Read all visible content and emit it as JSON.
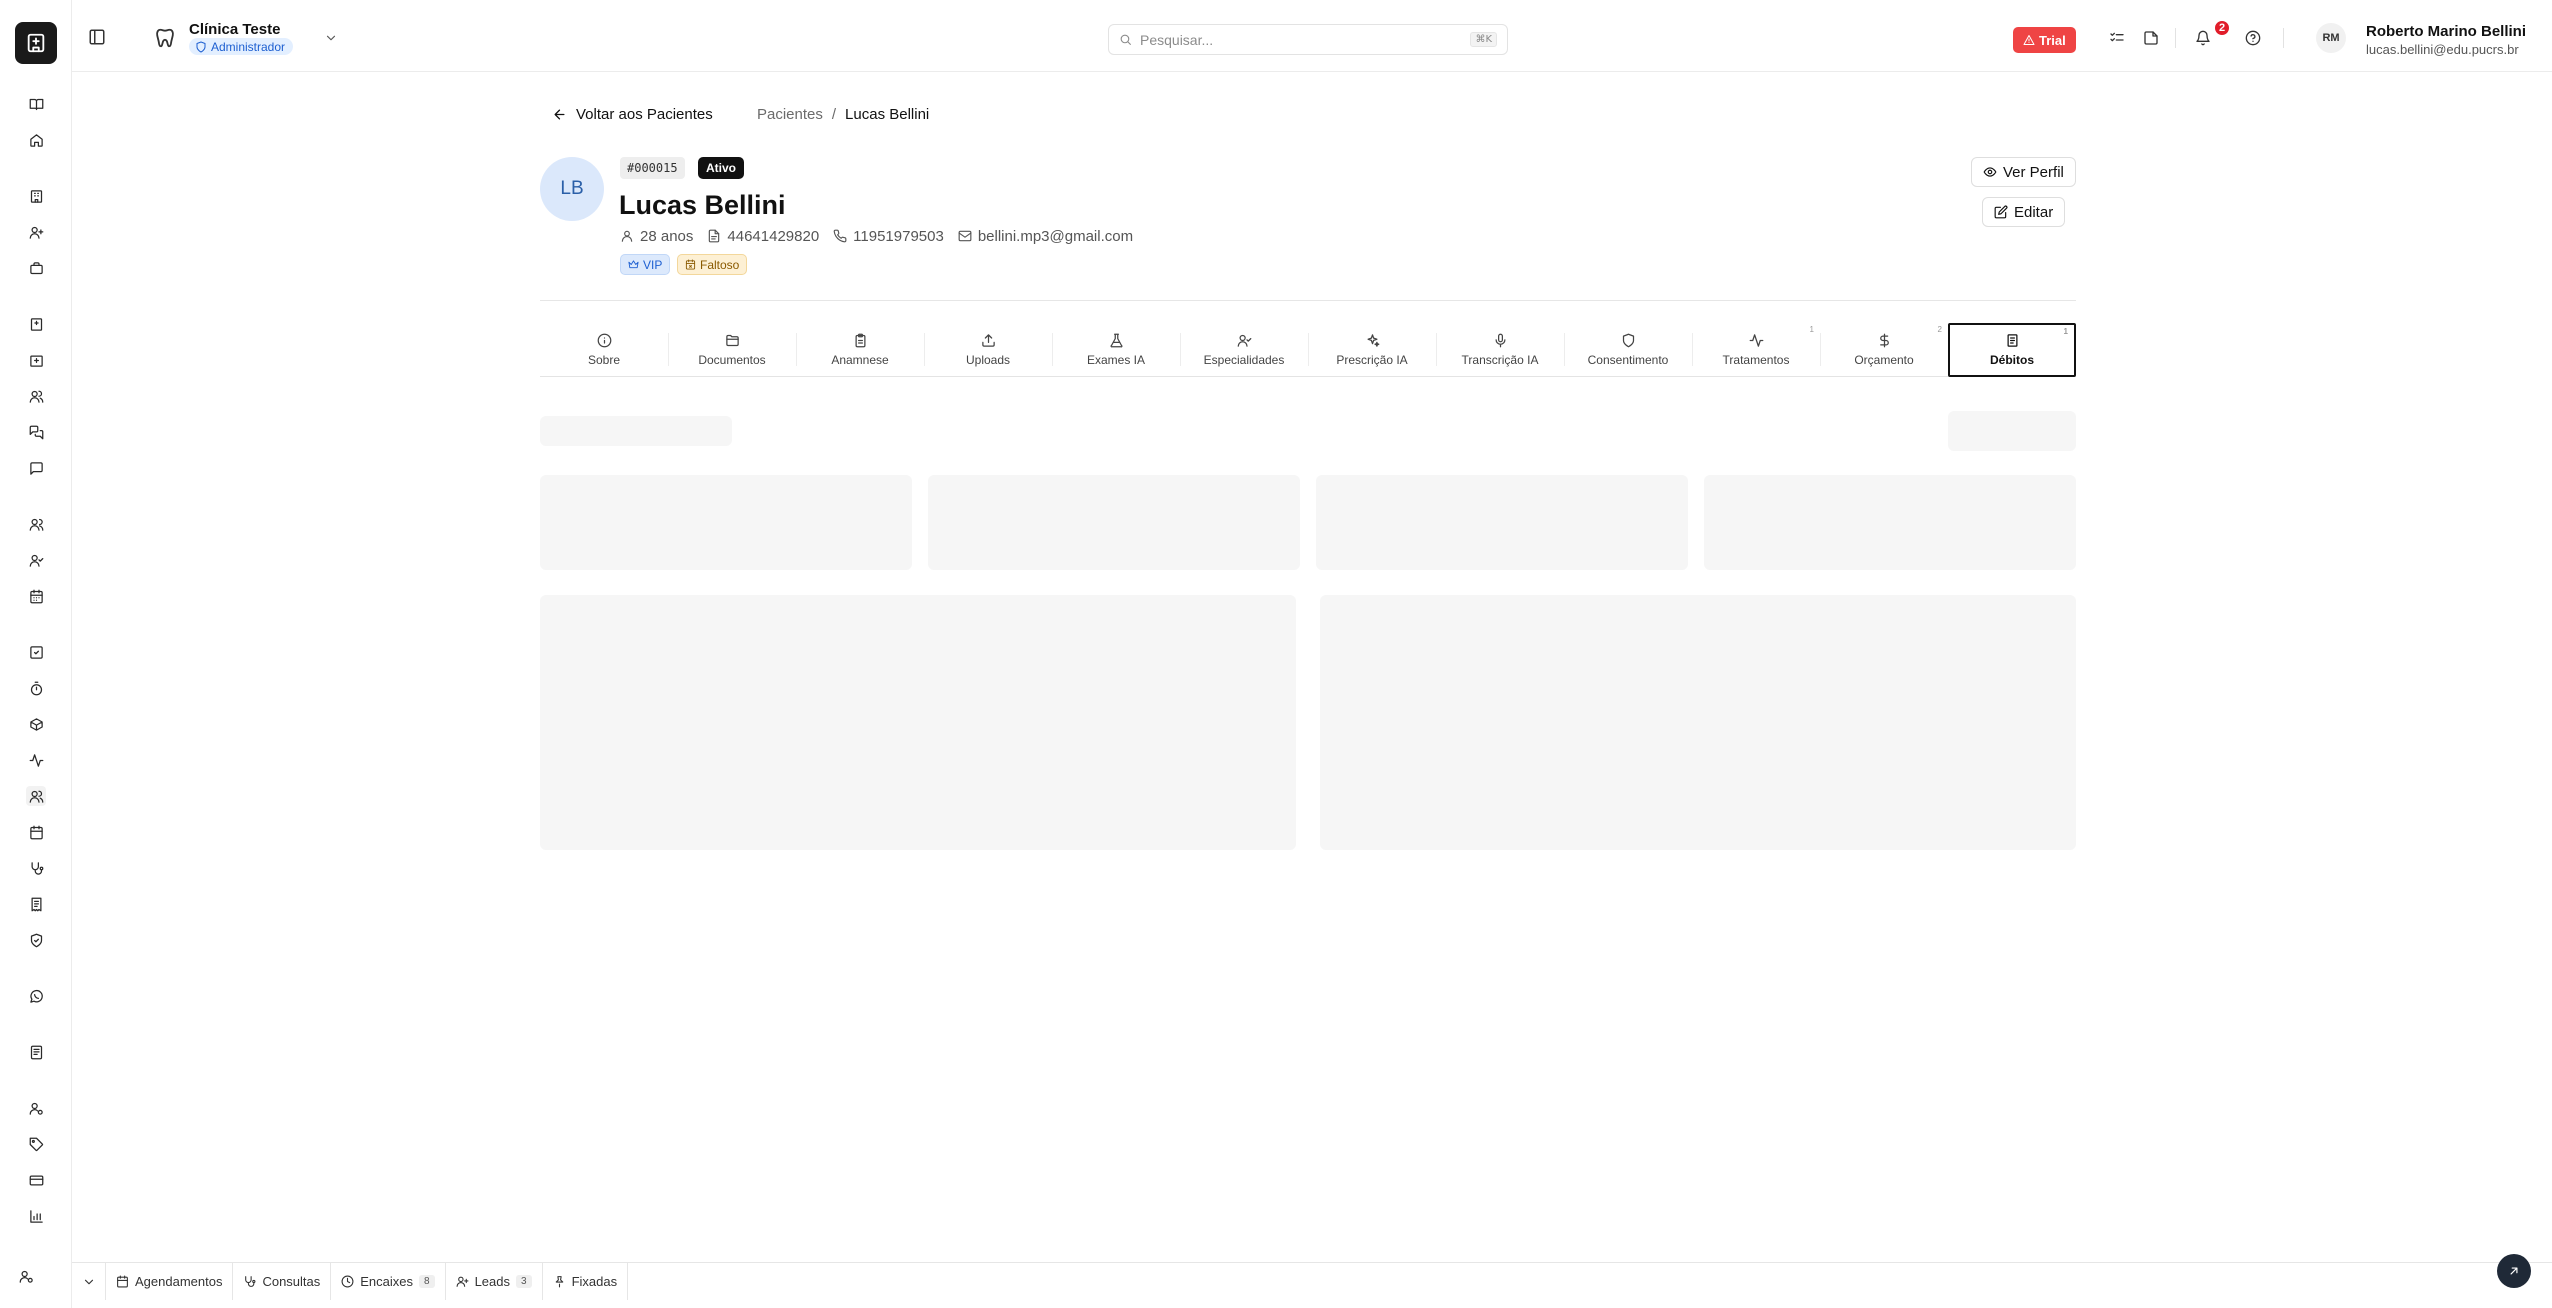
{
  "header": {
    "clinic_name": "Clínica Teste",
    "role": "Administrador",
    "search_placeholder": "Pesquisar...",
    "search_shortcut": "⌘K",
    "trial_label": "Trial",
    "notification_count": "2",
    "user_initials": "RM",
    "user_name": "Roberto Marino Bellini",
    "user_email": "lucas.bellini@edu.pucrs.br"
  },
  "nav": {
    "back_label": "Voltar aos Pacientes",
    "breadcrumb_parent": "Pacientes",
    "breadcrumb_sep": "/",
    "breadcrumb_current": "Lucas Bellini"
  },
  "patient": {
    "initials": "LB",
    "id": "#000015",
    "status": "Ativo",
    "name": "Lucas Bellini",
    "age": "28 anos",
    "document": "44641429820",
    "phone": "11951979503",
    "email": "bellini.mp3@gmail.com",
    "tags": [
      "VIP",
      "Faltoso"
    ]
  },
  "actions": {
    "view_profile": "Ver Perfil",
    "edit": "Editar"
  },
  "tabs": [
    {
      "label": "Sobre",
      "icon": "info-icon"
    },
    {
      "label": "Documentos",
      "icon": "folder-icon"
    },
    {
      "label": "Anamnese",
      "icon": "clipboard-icon"
    },
    {
      "label": "Uploads",
      "icon": "upload-icon"
    },
    {
      "label": "Exames IA",
      "icon": "flask-icon"
    },
    {
      "label": "Especialidades",
      "icon": "user-check-icon"
    },
    {
      "label": "Prescrição IA",
      "icon": "sparkles-icon"
    },
    {
      "label": "Transcrição IA",
      "icon": "mic-icon"
    },
    {
      "label": "Consentimento",
      "icon": "shield-icon"
    },
    {
      "label": "Tratamentos",
      "icon": "activity-icon",
      "count": "1"
    },
    {
      "label": "Orçamento",
      "icon": "dollar-icon",
      "count": "2"
    },
    {
      "label": "Débitos",
      "icon": "receipt-icon",
      "count": "1",
      "active": true
    }
  ],
  "bottom_bar": {
    "items": [
      {
        "label": "Agendamentos",
        "icon": "calendar-icon"
      },
      {
        "label": "Consultas",
        "icon": "stethoscope-icon"
      },
      {
        "label": "Encaixes",
        "icon": "clock-icon",
        "count": "8"
      },
      {
        "label": "Leads",
        "icon": "user-plus-icon",
        "count": "3"
      },
      {
        "label": "Fixadas",
        "icon": "pin-icon"
      }
    ]
  },
  "colors": {
    "primary": "#111111",
    "trial": "#ef4444",
    "notification": "#e11d2a",
    "role_badge_bg": "#e3efff",
    "vip_bg": "#dce9fc",
    "faltoso_bg": "#fdf0d4",
    "skeleton": "#f6f6f6"
  }
}
